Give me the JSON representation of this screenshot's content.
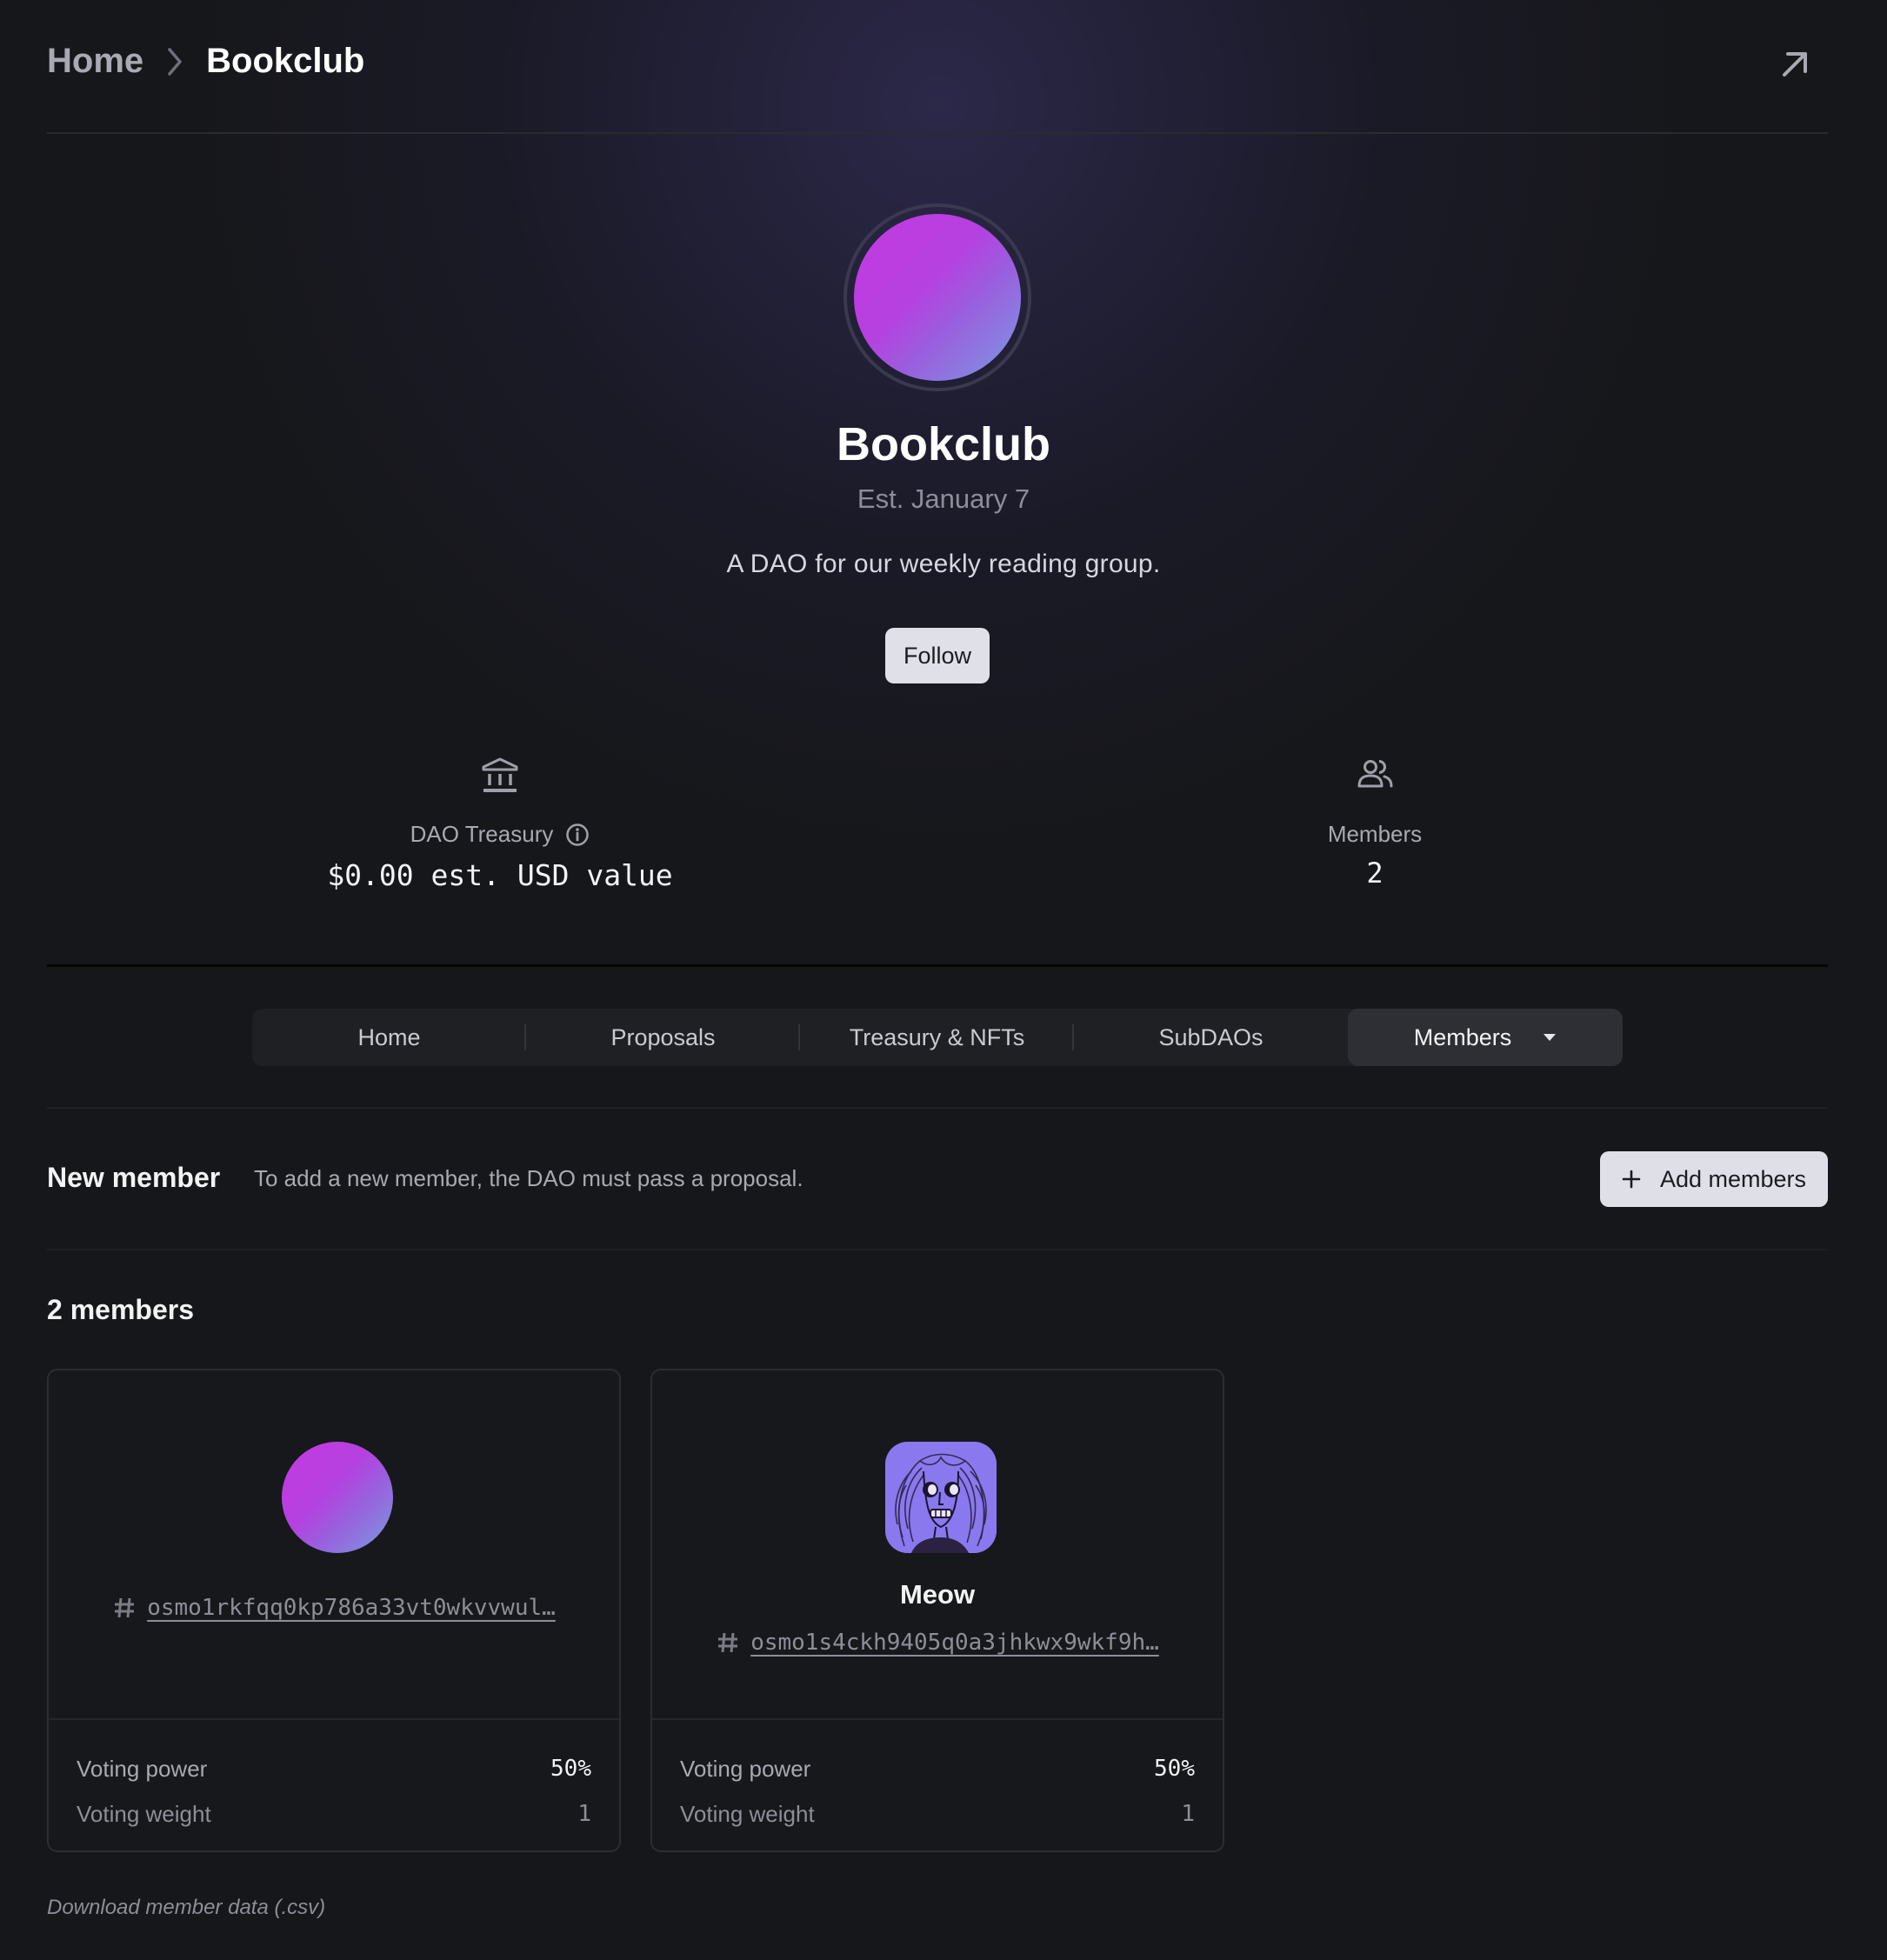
{
  "breadcrumb": {
    "home": "Home",
    "current": "Bookclub"
  },
  "header": {
    "external_icon": "arrow-up-right-icon"
  },
  "dao": {
    "name": "Bookclub",
    "established": "Est. January 7",
    "description": "A DAO for our weekly reading group.",
    "follow_label": "Follow",
    "avatar_gradient": [
      "#c43be2",
      "#7a9be0"
    ]
  },
  "stats": {
    "treasury": {
      "icon": "bank-icon",
      "label": "DAO Treasury",
      "info_icon": "info-icon",
      "value": "$0.00 est. USD value"
    },
    "members": {
      "icon": "users-icon",
      "label": "Members",
      "value": "2"
    }
  },
  "tabs": [
    {
      "label": "Home",
      "active": false
    },
    {
      "label": "Proposals",
      "active": false
    },
    {
      "label": "Treasury & NFTs",
      "active": false
    },
    {
      "label": "SubDAOs",
      "active": false
    },
    {
      "label": "Members",
      "active": true,
      "icon": "caret-down-icon"
    }
  ],
  "new_member": {
    "title": "New member",
    "description": "To add a new member, the DAO must pass a proposal.",
    "add_label": "Add members",
    "add_icon": "plus-icon"
  },
  "members_section": {
    "count_label": "2 members",
    "members": [
      {
        "name": "",
        "avatar": "gradient-circle",
        "address": "osmo1rkfqq0kp786a33vt0wkvvwul…",
        "voting_power_label": "Voting power",
        "voting_power": "50%",
        "voting_weight_label": "Voting weight",
        "voting_weight": "1"
      },
      {
        "name": "Meow",
        "avatar": "drawn-face-image",
        "address": "osmo1s4ckh9405q0a3jhkwx9wkf9h…",
        "voting_power_label": "Voting power",
        "voting_power": "50%",
        "voting_weight_label": "Voting weight",
        "voting_weight": "1"
      }
    ]
  },
  "download_label": "Download member data (.csv)",
  "colors": {
    "background": "#16171a",
    "button_bg": "#e0e1e8",
    "tab_bar_bg": "#1f2024",
    "tab_active_bg": "#2e2f34",
    "muted_text": "#a8a9b2"
  }
}
